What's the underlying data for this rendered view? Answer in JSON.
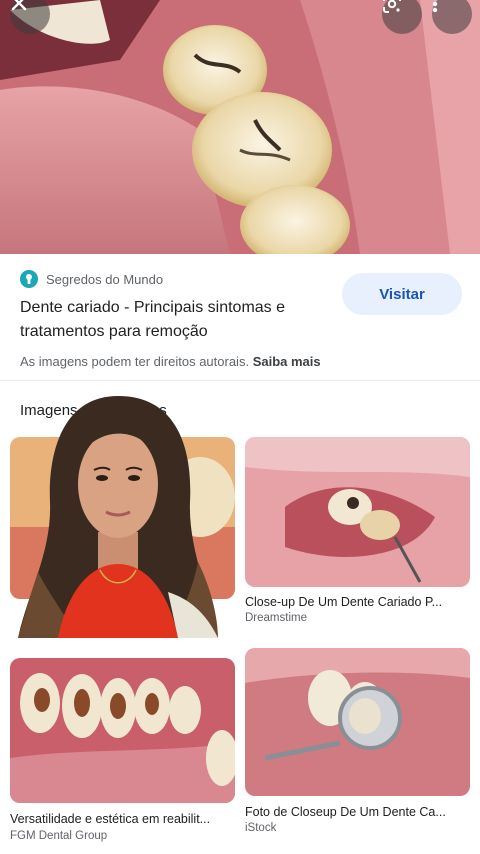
{
  "header": {
    "close_icon": "close-icon",
    "lens_icon": "google-lens-icon",
    "more_icon": "more-vert-icon"
  },
  "result": {
    "source": "Segredos do Mundo",
    "title": "Dente cariado - Principais sintomas e tratamentos para remoção",
    "visit_label": "Visitar",
    "rights_text": "As imagens podem ter direitos autorais.",
    "rights_link": "Saiba mais"
  },
  "related": {
    "heading": "Imagens relacionadas",
    "items": [
      {
        "caption": "",
        "source": ""
      },
      {
        "caption": "Close-up De Um Dente Cariado P...",
        "source": "Dreamstime"
      },
      {
        "caption": "Versatilidade e estética em reabilit...",
        "source": "FGM Dental Group"
      },
      {
        "caption": "Foto de Closeup De Um Dente Ca...",
        "source": "iStock"
      }
    ]
  },
  "colors": {
    "accent": "#1a56b0",
    "visit_bg": "#e8f0fe",
    "source_icon": "#1aa7b8"
  }
}
